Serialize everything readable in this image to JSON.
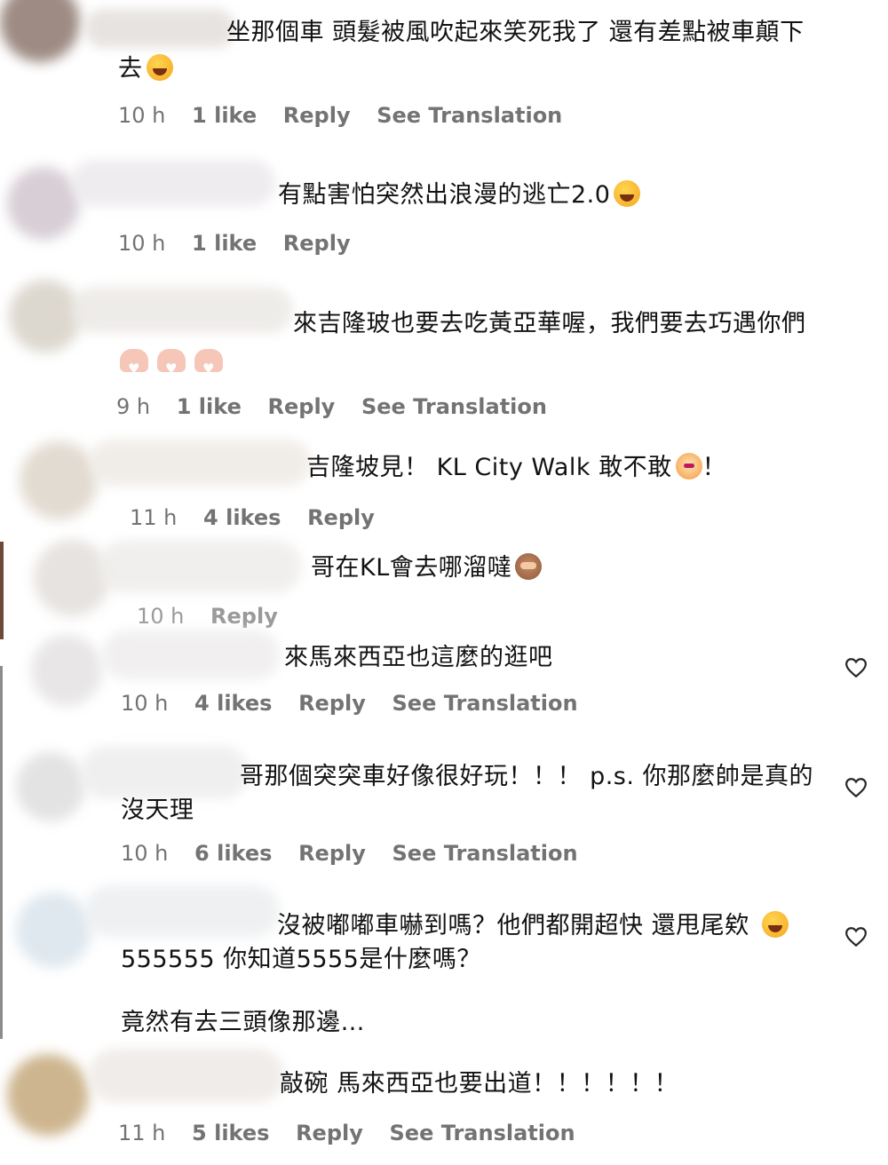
{
  "comments": [
    {
      "line1": "坐那個車 頭髮被風吹起來笑死我了 還有差點被車顛下",
      "line2": "去",
      "time": "10 h",
      "likes": "1 like",
      "reply": "Reply",
      "translate": "See Translation"
    },
    {
      "line1": "有點害怕突然出浪漫的逃亡2.0",
      "time": "10 h",
      "likes": "1 like",
      "reply": "Reply"
    },
    {
      "line1": "來吉隆玻也要去吃黃亞華喔，我們要去巧遇你們",
      "time": "9 h",
      "likes": "1 like",
      "reply": "Reply",
      "translate": "See Translation"
    },
    {
      "line1": "吉隆坡見！ KL City Walk 敢不敢",
      "line1_suffix": "！",
      "time": "11 h",
      "likes": "4 likes",
      "reply": "Reply"
    },
    {
      "line1": "哥在KL會去哪溜噠",
      "time": "10 h",
      "reply": "Reply"
    },
    {
      "line1": "來馬來西亞也這麼的逛吧",
      "time": "10 h",
      "likes": "4 likes",
      "reply": "Reply",
      "translate": "See Translation"
    },
    {
      "line1": "哥那個突突車好像很好玩！！！ p.s. 你那麼帥是真的",
      "line2": "沒天理",
      "time": "10 h",
      "likes": "6 likes",
      "reply": "Reply",
      "translate": "See Translation"
    },
    {
      "line1": "沒被嘟嘟車嚇到嗎？他們都開超快 還甩尾欸",
      "line2": "555555 你知道5555是什麼嗎？",
      "line3": "竟然有去三頭像那邊…"
    },
    {
      "line1": "敲碗 馬來西亞也要出道！！！！！！",
      "time": "11 h",
      "likes": "5 likes",
      "reply": "Reply",
      "translate": "See Translation"
    }
  ],
  "icons": {
    "like": "heart-outline-icon",
    "emoji_laugh": "rolling-laughing-emoji",
    "emoji_grin": "grinning-squinting-emoji",
    "emoji_tiger": "tiger-face-emoji",
    "emoji_monkey": "see-no-evil-monkey-emoji",
    "emoji_heart_hands": "heart-hands-emoji"
  }
}
